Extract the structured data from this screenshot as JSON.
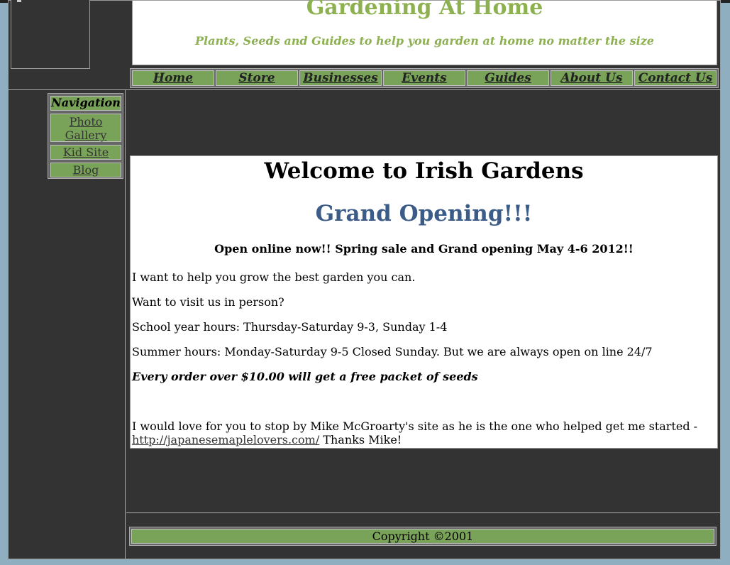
{
  "header": {
    "site_title": "Gardening At Home",
    "tagline": "Plants, Seeds and Guides to help you garden at home no matter the size"
  },
  "nav": {
    "items": [
      {
        "label": "Home"
      },
      {
        "label": "Store"
      },
      {
        "label": "Businesses"
      },
      {
        "label": "Events"
      },
      {
        "label": "Guides"
      },
      {
        "label": "About Us"
      },
      {
        "label": "Contact Us"
      }
    ]
  },
  "sidebar": {
    "heading": "Navigation",
    "items": [
      {
        "label": "Photo Gallery"
      },
      {
        "label": "Kid Site"
      },
      {
        "label": "Blog"
      }
    ]
  },
  "main": {
    "welcome": "Welcome to Irish Gardens",
    "grand_opening": "Grand Opening!!!",
    "open_online": "Open online now!!  Spring sale and Grand opening May 4-6 2012!!",
    "p1": "I want to help you grow the best garden you can.",
    "p2": "Want to visit us in person?",
    "p3": "School year hours: Thursday-Saturday 9-3, Sunday 1-4",
    "p4": "Summer hours: Monday-Saturday 9-5 Closed Sunday.  But we are always open on line 24/7",
    "p5": "Every order over $10.00 will get a free packet of seeds",
    "p6_line1": "I would love for you to stop by Mike McGroarty's site as he is the one who helped get me started -",
    "p6_link": "http://japanesemaplelovers.com/",
    "p6_after": " Thanks Mike!"
  },
  "footer": {
    "copyright": "Copyright ©2001"
  },
  "colors": {
    "page_bg": "#333333",
    "outer_bg": "#8fafc0",
    "accent_green": "#7aa35a",
    "title_green": "#8db050",
    "heading_blue": "#3b5b88"
  }
}
